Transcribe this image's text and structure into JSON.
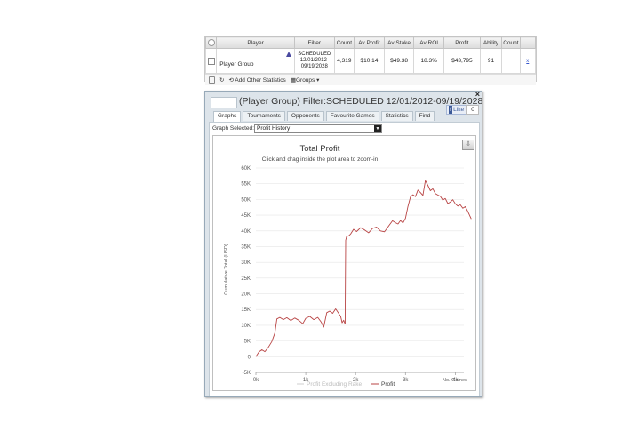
{
  "stats_table": {
    "headers": [
      "Player",
      "Filter",
      "Count",
      "Av Profit",
      "Av Stake",
      "Av ROI",
      "Profit",
      "Ability",
      "Count"
    ],
    "row": {
      "player": "Player Group",
      "filter": [
        "SCHEDULED",
        "12/01/2012-",
        "09/19/2028"
      ],
      "count": "4,319",
      "av_profit": "$10.14",
      "av_stake": "$49.38",
      "av_roi": "18.3%",
      "profit": "$43,795",
      "ability": "91",
      "count2": "",
      "expand": "x"
    },
    "footer": {
      "add_stats": "Add Other Statistics",
      "groups": "Groups ▾"
    }
  },
  "window": {
    "title": "(Player Group) Filter:SCHEDULED 12/01/2012-09/19/2028",
    "close": "×",
    "fb_like": "Like",
    "fb_count": "0",
    "tabs": [
      "Graphs",
      "Tournaments",
      "Opponents",
      "Favourite Games",
      "Statistics",
      "Find"
    ],
    "active_tab": 0,
    "graph_selected_label": "Graph Selected:",
    "graph_selected_value": "Profit History"
  },
  "chart_data": {
    "type": "line",
    "title": "Total Profit",
    "subtitle": "Click and drag inside the plot area to zoom-in",
    "xlabel": "No. Games",
    "ylabel": "Cumulative Total (USD)",
    "x_ticks": [
      "0k",
      "1k",
      "2k",
      "3k",
      "4k"
    ],
    "y_ticks": [
      "-5K",
      "0",
      "5K",
      "10K",
      "15K",
      "20K",
      "25K",
      "30K",
      "35K",
      "40K",
      "45K",
      "50K",
      "55K",
      "60K"
    ],
    "xlim": [
      0,
      4319
    ],
    "ylim": [
      -5000,
      60000
    ],
    "grid": true,
    "legend": [
      "Profit Excluding Rake",
      "Profit"
    ],
    "colors": {
      "profit": "#b84444",
      "excluding_rake": "#cfcfcf"
    },
    "series": [
      {
        "name": "Profit",
        "x": [
          0,
          60,
          120,
          180,
          250,
          320,
          380,
          420,
          480,
          550,
          620,
          700,
          780,
          860,
          940,
          1000,
          1080,
          1160,
          1240,
          1310,
          1360,
          1420,
          1480,
          1540,
          1600,
          1650,
          1700,
          1730,
          1760,
          1790,
          1800,
          1820,
          1860,
          1900,
          1960,
          2020,
          2100,
          2180,
          2260,
          2340,
          2420,
          2500,
          2580,
          2660,
          2740,
          2800,
          2850,
          2900,
          2950,
          3000,
          3050,
          3100,
          3150,
          3200,
          3250,
          3300,
          3350,
          3400,
          3450,
          3500,
          3550,
          3600,
          3650,
          3700,
          3750,
          3800,
          3850,
          3900,
          3950,
          4000,
          4050,
          4100,
          4150,
          4200,
          4250,
          4319
        ],
        "values": [
          0,
          1500,
          2200,
          1600,
          3000,
          4800,
          7500,
          12000,
          12500,
          11800,
          12400,
          11500,
          12300,
          11600,
          10500,
          12200,
          12800,
          11800,
          12500,
          11000,
          9400,
          14000,
          14500,
          13800,
          15200,
          14000,
          12800,
          10800,
          11600,
          10400,
          37000,
          38200,
          38400,
          39000,
          40500,
          39800,
          41000,
          40300,
          39400,
          40800,
          41200,
          40000,
          39700,
          41500,
          43200,
          42600,
          42200,
          43300,
          42500,
          44000,
          47800,
          50800,
          51500,
          50900,
          53000,
          52200,
          51300,
          56000,
          54500,
          52800,
          53400,
          51900,
          51400,
          51000,
          49800,
          50300,
          48700,
          49200,
          49900,
          48600,
          47900,
          48300,
          47200,
          47700,
          46200,
          43795
        ]
      }
    ]
  }
}
